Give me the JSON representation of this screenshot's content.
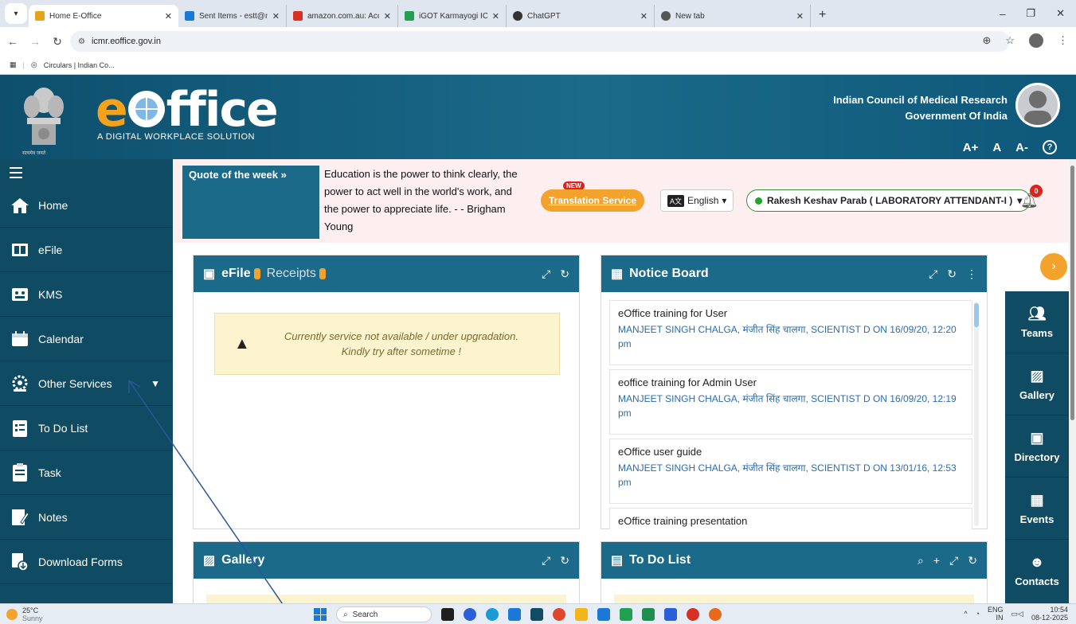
{
  "browser": {
    "tabs": [
      {
        "title": "Home E-Office",
        "color": "#e6a31a",
        "active": true
      },
      {
        "title": "Sent Items - estt@nirrh.res.in - ",
        "color": "#1a78d6"
      },
      {
        "title": "amazon.com.au: Account confi",
        "color": "#d93025"
      },
      {
        "title": "iGOT Karmayogi ICMR-NIRRCH",
        "color": "#20a050"
      },
      {
        "title": "ChatGPT",
        "color": "#333333"
      },
      {
        "title": "New tab",
        "color": "#555555"
      }
    ],
    "new_tab": "+",
    "url": "icmr.eoffice.gov.in",
    "bookmark": "Circulars | Indian Co..."
  },
  "header": {
    "logo_text": "ffice",
    "logo_e": "e",
    "logo_sub": "A DIGITAL WORKPLACE SOLUTION",
    "emblem_text": "सत्यमेव जयते",
    "org_line1": "Indian Council of Medical Research",
    "org_line2": "Government Of India",
    "font_controls": [
      "A+",
      "A",
      "A-"
    ],
    "help": "?"
  },
  "sidebar": {
    "items": [
      {
        "label": "Home",
        "icon": "home-icon"
      },
      {
        "label": "eFile",
        "icon": "efile-icon"
      },
      {
        "label": "KMS",
        "icon": "kms-icon"
      },
      {
        "label": "Calendar",
        "icon": "calendar-icon"
      },
      {
        "label": "Other Services",
        "icon": "services-icon",
        "caret": "▼"
      },
      {
        "label": "To Do List",
        "icon": "todo-icon"
      },
      {
        "label": "Task",
        "icon": "task-icon"
      },
      {
        "label": "Notes",
        "icon": "notes-icon"
      },
      {
        "label": "Download Forms",
        "icon": "download-forms-icon"
      }
    ]
  },
  "quote": {
    "label": "Quote of the week",
    "arrow": "»",
    "text": "Education is the power to think clearly, the power to act well in the world's work, and the power to appreciate life. - - Brigham Young"
  },
  "toolbar": {
    "new_badge": "NEW",
    "translation": "Translation Service",
    "language": "English",
    "user": "Rakesh Keshav Parab ( LABORATORY ATTENDANT-I )",
    "notifications": "0"
  },
  "efile_panel": {
    "title": "eFile",
    "receipts": "Receipts",
    "warning_line1": "Currently service not available / under upgradation.",
    "warning_line2": "Kindly try after sometime !"
  },
  "notice_board": {
    "title": "Notice Board",
    "notices": [
      {
        "title": "eOffice training for User",
        "meta": "MANJEET SINGH CHALGA, मंजीत सिंह चालगा, SCIENTIST D ON 16/09/20, 12:20 pm"
      },
      {
        "title": "eoffice training for Admin User",
        "meta": "MANJEET SINGH CHALGA, मंजीत सिंह चालगा, SCIENTIST D ON 16/09/20, 12:19 pm"
      },
      {
        "title": "eOffice user guide",
        "meta": "MANJEET SINGH CHALGA, मंजीत सिंह चालगा, SCIENTIST D ON 13/01/16, 12:53 pm"
      },
      {
        "title": "eOffice training presentation",
        "meta": ""
      }
    ]
  },
  "gallery_panel": {
    "title": "Gallery"
  },
  "todo_panel": {
    "title": "To Do List"
  },
  "rail": {
    "expand": "›",
    "items": [
      {
        "label": "Teams",
        "icon": "teams-icon"
      },
      {
        "label": "Gallery",
        "icon": "gallery-icon"
      },
      {
        "label": "Directory",
        "icon": "directory-icon"
      },
      {
        "label": "Events",
        "icon": "events-icon"
      },
      {
        "label": "Contacts",
        "icon": "contacts-icon"
      }
    ]
  },
  "taskbar": {
    "temp": "25°C",
    "weather": "Sunny",
    "search": "Search",
    "lang": "ENG",
    "region": "IN",
    "time": "10:54",
    "date": "08-12-2025",
    "app_colors": [
      "#1f1f1f",
      "#2b5fd9",
      "#1a9ad6",
      "#1a78d6",
      "#0f4c63",
      "#e0452e",
      "#f3b51a",
      "#1a78d6",
      "#20a050",
      "#1f8f4f",
      "#2b5fd9",
      "#d93025",
      "#e66a1a"
    ]
  }
}
